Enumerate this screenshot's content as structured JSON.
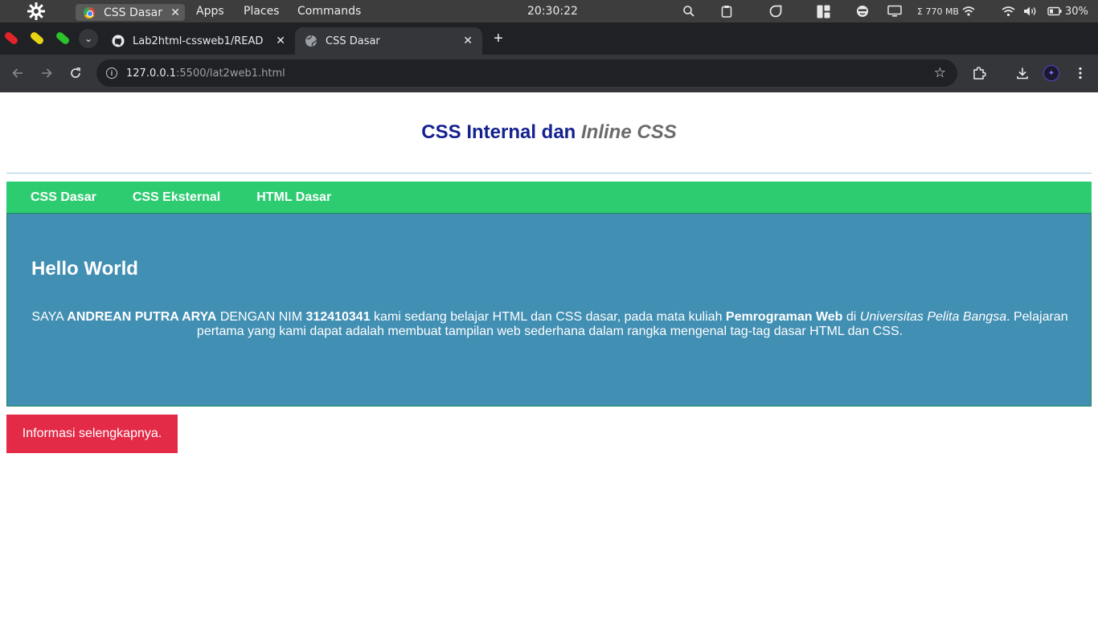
{
  "system_bar": {
    "task_label": "CSS Dasar",
    "menus": [
      "Apps",
      "Places",
      "Commands"
    ],
    "clock": "20:30:22",
    "memory": "Σ 770 MB",
    "battery": "30%",
    "icons": [
      "os-logo-icon",
      "search-icon",
      "clipboard-icon",
      "circle-icon",
      "layout-icon",
      "face-icon",
      "monitor-icon",
      "wifi-icon",
      "volume-icon",
      "battery-icon"
    ]
  },
  "browser": {
    "tabs": [
      {
        "title": "Lab2html-cssweb1/READ",
        "icon": "github-icon"
      },
      {
        "title": "CSS Dasar",
        "icon": "globe-icon",
        "active": true
      }
    ],
    "url_host": "127.0.0.1",
    "url_rest": ":5500/lat2web1.html",
    "extension_colors": [
      "#e0242a",
      "#e7d514",
      "#2bc22b"
    ]
  },
  "page": {
    "title_main": "CSS Internal dan",
    "title_em": "Inline CSS",
    "nav": [
      "CSS Dasar",
      "CSS Eksternal",
      "HTML Dasar"
    ],
    "hero_title": "Hello World",
    "hero_text": {
      "p1": "SAYA ",
      "name": "ANDREAN PUTRA ARYA",
      "p2": " DENGAN NIM ",
      "nim": "312410341",
      "p3": " kami sedang belajar HTML dan CSS dasar, pada mata kuliah ",
      "course": "Pemrograman Web",
      "p4": " di ",
      "univ": "Universitas Pelita Bangsa",
      "p5": ". Pelajaran pertama yang kami dapat adalah membuat tampilan web sederhana dalam rangka mengenal tag-tag dasar HTML dan CSS."
    },
    "button_label": "Informasi selengkapnya.",
    "colors": {
      "header_title": "#14218f",
      "nav_bg": "#2ecc71",
      "hero_bg": "#418fb3",
      "button_bg": "#e32b48"
    }
  }
}
